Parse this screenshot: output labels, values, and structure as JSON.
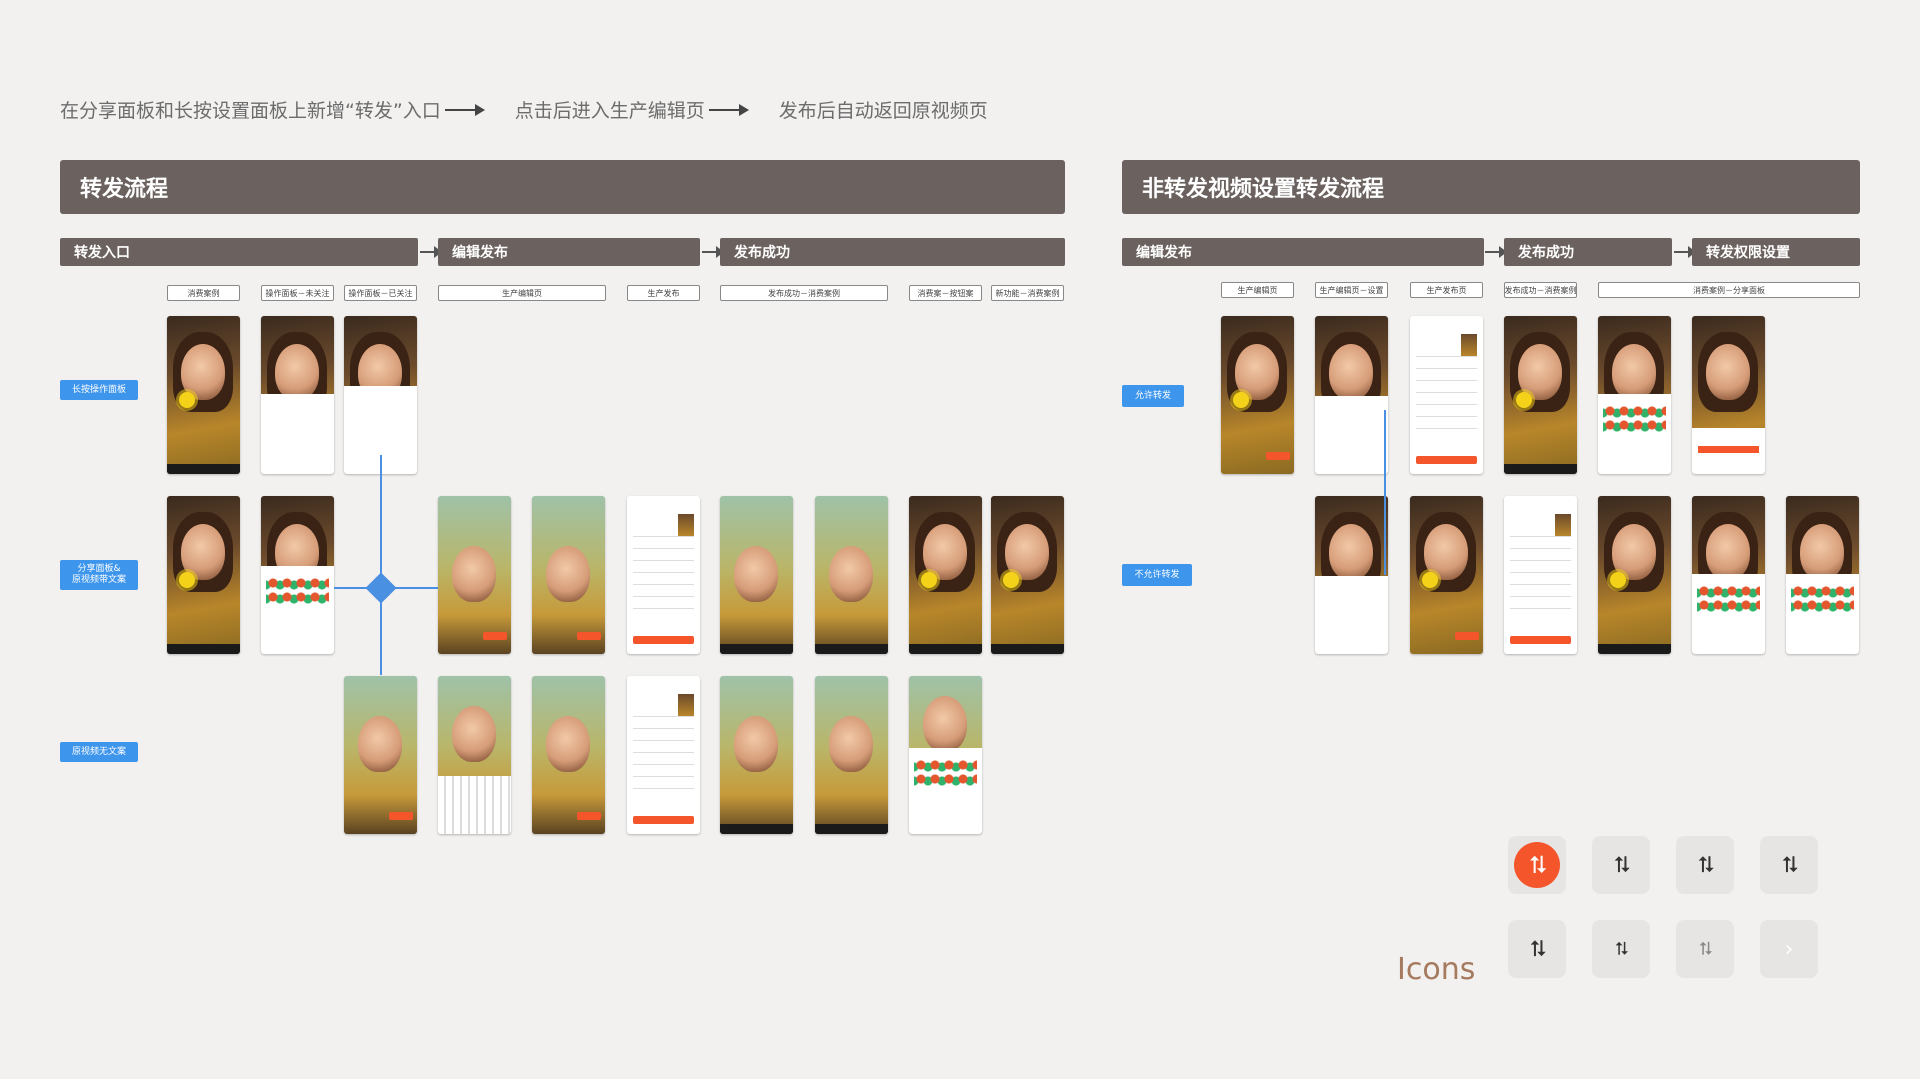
{
  "header_flow": {
    "step1": "在分享面板和长按设置面板上新增“转发”入口",
    "step2": "点击后进入生产编辑页",
    "step3": "发布后自动返回原视频页"
  },
  "left_panel": {
    "title": "转发流程",
    "phases": [
      "转发入口",
      "编辑发布",
      "发布成功"
    ],
    "sublabels": [
      "消费案例",
      "操作面板－未关注",
      "操作面板－已关注",
      "生产编辑页",
      "生产发布",
      "发布成功－消费案例",
      "消费案－按钮案",
      "新功能－消费案例"
    ],
    "rows": [
      "长按操作面板",
      "分享面板&\n原视频带文案",
      "原视频无文案"
    ]
  },
  "right_panel": {
    "title": "非转发视频设置转发流程",
    "phases": [
      "编辑发布",
      "发布成功",
      "转发权限设置"
    ],
    "sublabels": [
      "生产编辑页",
      "生产编辑页－设置",
      "生产发布页",
      "发布成功－消费案例",
      "消费案例－分享面板"
    ],
    "rows": [
      "允许转发",
      "不允许转发"
    ]
  },
  "icons": {
    "title": "Icons",
    "items": [
      {
        "name": "repost-filled-icon",
        "glyph": "⮁"
      },
      {
        "name": "repost-icon",
        "glyph": "⮁"
      },
      {
        "name": "repost-settings-icon",
        "glyph": "⮁"
      },
      {
        "name": "repost-outline-icon",
        "glyph": "⮁"
      },
      {
        "name": "repost-badge-icon",
        "glyph": "⮁"
      },
      {
        "name": "repost-small-icon",
        "glyph": "⮁"
      },
      {
        "name": "repost-faint-icon",
        "glyph": "⮁"
      },
      {
        "name": "chevron-right-icon",
        "glyph": "›"
      }
    ]
  },
  "colors": {
    "panel_header": "#6b625f",
    "row_label": "#3d95ec",
    "accent": "#f4552b"
  }
}
